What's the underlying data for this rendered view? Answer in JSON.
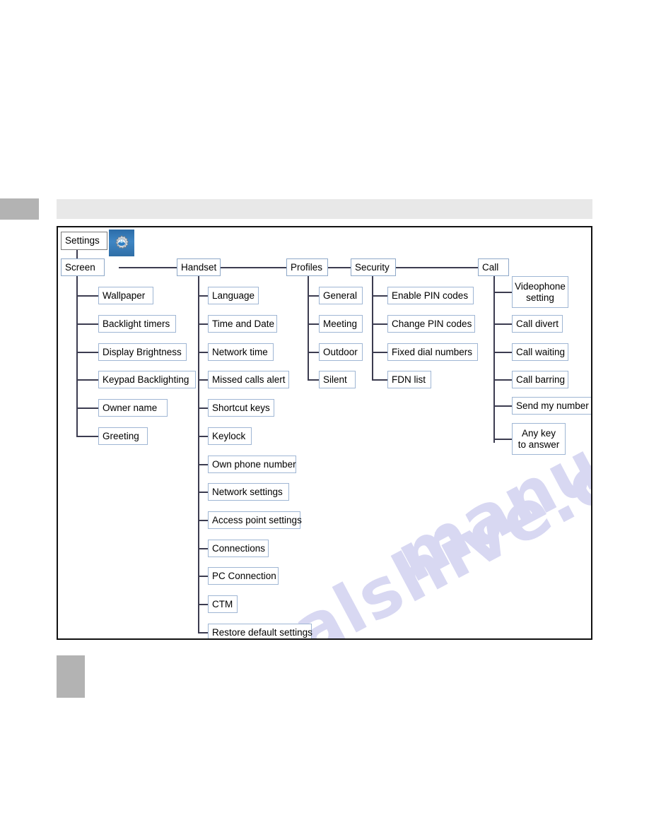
{
  "page": {
    "header_bar_color": "#e8e8e8",
    "marker_color": "#b3b3b3",
    "frame_border_color": "#111111",
    "node_border_color": "#9fb6d4",
    "connector_color": "#3c3c50",
    "watermark_color": "#d8d8f2"
  },
  "watermark": {
    "line_a": "manualshive.com",
    "line_b": "manualshive.com"
  },
  "diagram": {
    "type": "menu-tree",
    "root": {
      "label": "Settings",
      "icon": "gear-icon"
    },
    "branches": [
      {
        "label": "Screen",
        "children": [
          "Wallpaper",
          "Backlight timers",
          "Display Brightness",
          "Keypad Backlighting",
          "Owner name",
          "Greeting"
        ]
      },
      {
        "label": "Handset",
        "children": [
          "Language",
          "Time and Date",
          "Network time",
          "Missed calls alert",
          "Shortcut keys",
          "Keylock",
          "Own phone number",
          "Network settings",
          "Access point settings",
          "Connections",
          "PC Connection",
          "CTM",
          "Restore default settings"
        ]
      },
      {
        "label": "Profiles",
        "children": [
          "General",
          "Meeting",
          "Outdoor",
          "Silent"
        ]
      },
      {
        "label": "Security",
        "children": [
          "Enable PIN codes",
          "Change PIN codes",
          "Fixed dial numbers",
          "FDN list"
        ]
      },
      {
        "label": "Call",
        "children": [
          "Videophone\nsetting",
          "Call divert",
          "Call waiting",
          "Call barring",
          "Send my number",
          "Any key\nto answer"
        ]
      }
    ]
  }
}
